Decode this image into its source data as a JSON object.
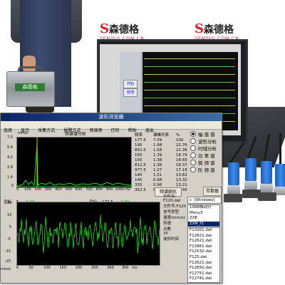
{
  "brand": {
    "name_left": "森德格",
    "name_right": "森德格",
    "url_left": "SENDIG.COM.CN",
    "url_right": "SENDIG.COM.CN",
    "case_label": "森德格"
  },
  "laptop": {
    "buttons": [
      "开始",
      "检测"
    ]
  },
  "window": {
    "title": "波形浏览器",
    "menu": [
      "选择",
      "显示",
      "采集方式",
      "报警方式",
      "频谱频",
      "打印",
      "帮助",
      "退出"
    ]
  },
  "spectrum": {
    "title": "频谱谱分析",
    "unit_label": "mm/s",
    "y_ticks": [
      "7.0",
      "5.6",
      "4.2",
      "2.8",
      "1.4",
      "0"
    ],
    "x_ticks": [
      "0",
      "100",
      "200",
      "300",
      "400",
      "500",
      "600",
      "700",
      "800",
      "900",
      "1000",
      "HZ"
    ],
    "readout_label_1": "显标:",
    "readout_value_1": "5",
    "readout_green_1": "0.04",
    "readout_label_2": "显标:",
    "readout_value_2": "177.5",
    "readout_green_2": "7.39",
    "table_headers": [
      "频率",
      "谱峰列表",
      "%"
    ],
    "table_rows": [
      [
        "177.5",
        "7.39",
        "100"
      ],
      [
        "195",
        "1.68",
        "22.76"
      ],
      [
        "852.5",
        "1.58",
        "21.36"
      ],
      [
        "150",
        "1.39",
        "18.79"
      ],
      [
        "155",
        "1.38",
        "18.65"
      ],
      [
        "812.5",
        "1.36",
        "18.37"
      ],
      [
        "977.5",
        "1.27",
        "17.18"
      ],
      [
        "140",
        "1.01",
        "13.62"
      ],
      [
        "145",
        "0.98",
        "13.32"
      ],
      [
        "335",
        "0.98",
        "13.21"
      ],
      [
        "352.5",
        "0.85",
        "11.45"
      ]
    ],
    "refine_button": "频谱细化"
  },
  "waveform": {
    "y_ticks": [
      "25",
      "15",
      "5",
      "-5",
      "-15",
      "-25"
    ],
    "x_ticks": [
      "0",
      "25",
      "50",
      "75",
      "100",
      "125",
      "150",
      "175",
      "200",
      "225",
      "250",
      "275",
      "300",
      "325",
      "350"
    ],
    "unit_label": "mm/s",
    "time_unit": "ms"
  },
  "modes": [
    {
      "label": "幅 值 谱",
      "selected": true
    },
    {
      "label": "波形分析",
      "selected": false
    },
    {
      "label": "时域分析",
      "selected": false
    },
    {
      "label": "功 率 谱",
      "selected": false
    },
    {
      "label": "倒 频 谱",
      "selected": false
    },
    {
      "label": "阶 频 谱",
      "selected": false
    }
  ],
  "fields": {
    "file_name_label": "文件名:",
    "file_name_value": "F120.dat",
    "file_number_label": "文件号:",
    "file_number_value": "F120",
    "signal_type_label": "信号类型",
    "signal_type_value": "速度(mm/s)",
    "speed_label": "转速",
    "points_label": "点数",
    "points_value": "35",
    "rate_label": "波形时间",
    "save_button": "存数据",
    "drive_value": "c: [Windows]"
  },
  "files": {
    "folders": [
      "1998振动分",
      "Mony3",
      "ZXE",
      "ZXN_f1"
    ],
    "items": [
      "F13201.dat",
      "F12821.dat",
      "F12621.dat",
      "F12861.dat",
      "F12532.dat",
      "F125.dat",
      "F12621.dat",
      "F12650.dat",
      "F12751.dat",
      "F12741.dat",
      "F13001.dat"
    ]
  },
  "colors": {
    "plot_bg": "#000000",
    "trace": "#22dd22",
    "titlebar": "#0a246a",
    "brand_red": "#d8222a",
    "sensor_blue": "#3f8bea"
  }
}
